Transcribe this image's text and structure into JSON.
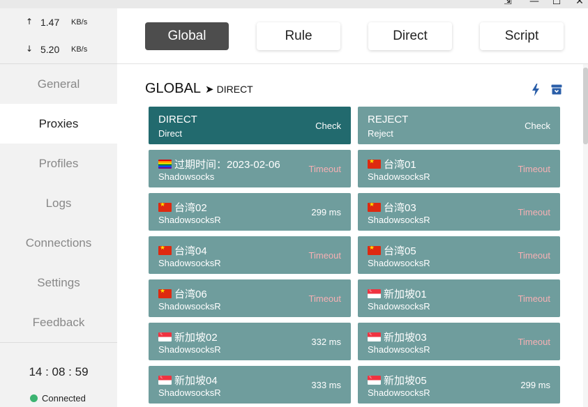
{
  "window": {
    "pin_glyph": "⇲",
    "min_glyph": "—",
    "max_glyph": "☐",
    "close_glyph": "✕"
  },
  "sidebar": {
    "traffic": {
      "up": {
        "arrow": "↑",
        "value": "1.47",
        "unit": "KB/s"
      },
      "down": {
        "arrow": "↓",
        "value": "5.20",
        "unit": "KB/s"
      }
    },
    "nav": [
      "General",
      "Proxies",
      "Profiles",
      "Logs",
      "Connections",
      "Settings",
      "Feedback"
    ],
    "active_nav": "Proxies",
    "clock": "14 : 08 : 59",
    "status": "Connected",
    "status_color": "#3cb371"
  },
  "modes": {
    "items": [
      "Global",
      "Rule",
      "Direct",
      "Script"
    ],
    "active": "Global"
  },
  "group": {
    "name": "GLOBAL",
    "arrow": "➤",
    "current": "DIRECT",
    "icons": [
      "bolt-icon",
      "archive-icon"
    ]
  },
  "proxies": [
    {
      "name": "DIRECT",
      "type": "Direct",
      "status": "Check",
      "flag": null,
      "selected": true
    },
    {
      "name": "REJECT",
      "type": "Reject",
      "status": "Check",
      "flag": null
    },
    {
      "name": "过期时间：2023-02-06",
      "type": "Shadowsocks",
      "status": "Timeout",
      "flag": "rainbow"
    },
    {
      "name": "台湾01",
      "type": "ShadowsocksR",
      "status": "Timeout",
      "flag": "cn"
    },
    {
      "name": "台湾02",
      "type": "ShadowsocksR",
      "status": "299 ms",
      "flag": "cn"
    },
    {
      "name": "台湾03",
      "type": "ShadowsocksR",
      "status": "Timeout",
      "flag": "cn"
    },
    {
      "name": "台湾04",
      "type": "ShadowsocksR",
      "status": "Timeout",
      "flag": "cn"
    },
    {
      "name": "台湾05",
      "type": "ShadowsocksR",
      "status": "Timeout",
      "flag": "cn"
    },
    {
      "name": "台湾06",
      "type": "ShadowsocksR",
      "status": "Timeout",
      "flag": "cn"
    },
    {
      "name": "新加坡01",
      "type": "ShadowsocksR",
      "status": "Timeout",
      "flag": "sg"
    },
    {
      "name": "新加坡02",
      "type": "ShadowsocksR",
      "status": "332 ms",
      "flag": "sg"
    },
    {
      "name": "新加坡03",
      "type": "ShadowsocksR",
      "status": "Timeout",
      "flag": "sg"
    },
    {
      "name": "新加坡04",
      "type": "ShadowsocksR",
      "status": "333 ms",
      "flag": "sg"
    },
    {
      "name": "新加坡05",
      "type": "ShadowsocksR",
      "status": "299 ms",
      "flag": "sg"
    }
  ],
  "colors": {
    "card": "#6f9d9d",
    "card_selected": "#226a6e",
    "timeout": "#f7b0b4",
    "active_mode": "#4d4d4d",
    "icon_blue": "#2a5ea8"
  }
}
